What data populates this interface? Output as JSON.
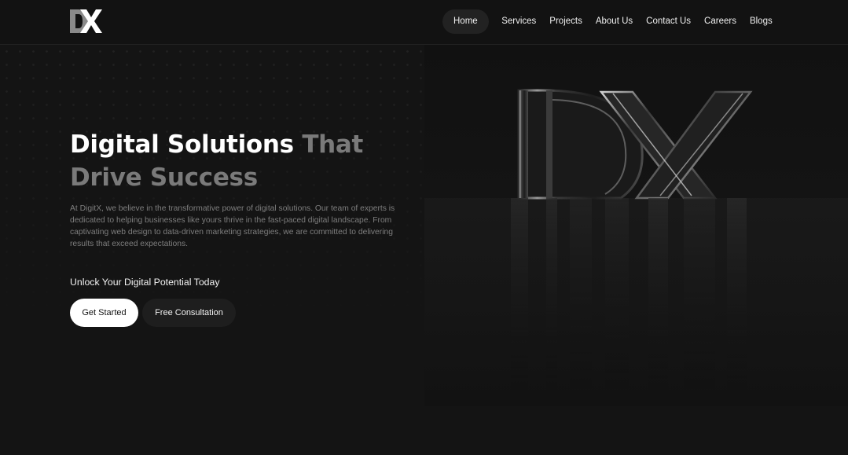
{
  "brand": {
    "logo_text": "DX"
  },
  "nav": {
    "items": [
      {
        "label": "Home",
        "active": true
      },
      {
        "label": "Services",
        "active": false
      },
      {
        "label": "Projects",
        "active": false
      },
      {
        "label": "About Us",
        "active": false
      },
      {
        "label": "Contact Us",
        "active": false
      },
      {
        "label": "Careers",
        "active": false
      },
      {
        "label": "Blogs",
        "active": false
      }
    ]
  },
  "hero": {
    "title_part1": "Digital Solutions ",
    "title_part2": "That",
    "title_part3": "Drive Success",
    "description": "At DigitX, we believe in the transformative power of digital solutions. Our team of experts is dedicated to helping businesses like yours thrive in the fast-paced digital landscape. From captivating web design to data-driven marketing strategies, we are committed to delivering results that exceed expectations.",
    "cta_label": "Unlock Your Digital Potential Today",
    "primary_button": "Get Started",
    "secondary_button": "Free Consultation"
  },
  "colors": {
    "background": "#141414",
    "title_white": "#ffffff",
    "title_gray": "#7a7a7a",
    "active_nav_bg": "#222222"
  }
}
